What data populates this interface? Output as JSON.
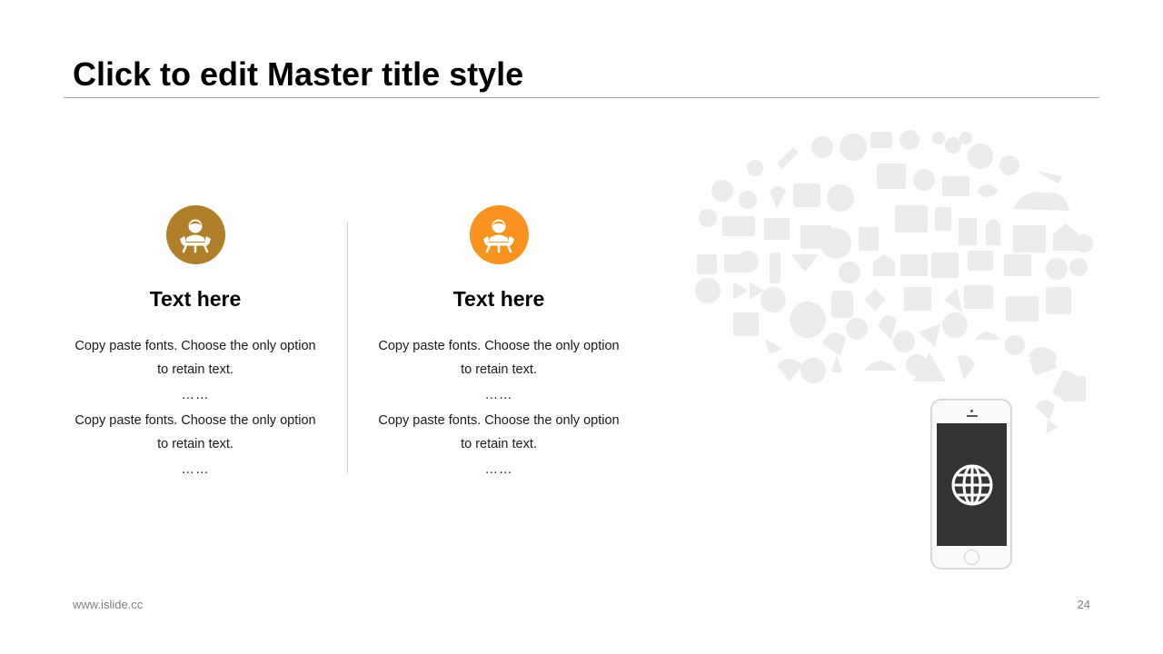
{
  "slide": {
    "title": "Click to edit Master title style",
    "columns": [
      {
        "accent": "#b07f2a",
        "icon": "user-at-desk-icon",
        "heading": "Text here",
        "para1_line1": "Copy paste fonts. Choose the only option",
        "para1_line2": "to retain text.",
        "dots1": "……",
        "para2_line1": "Copy paste fonts. Choose the only option",
        "para2_line2": "to retain text.",
        "dots2": "……"
      },
      {
        "accent": "#f7931e",
        "icon": "user-at-desk-icon",
        "heading": "Text here",
        "para1_line1": "Copy paste fonts. Choose the only option",
        "para1_line2": "to retain text.",
        "dots1": "……",
        "para2_line1": "Copy paste fonts. Choose the only option",
        "para2_line2": "to retain text.",
        "dots2": "……"
      }
    ],
    "decor": {
      "icon_cloud": "social-media-icon-cloud",
      "icon_cloud_color": "#ececec",
      "phone_icon": "globe-icon",
      "phone_screen_color": "#333333"
    }
  },
  "footer": {
    "url": "www.islide.cc",
    "page_number": "24"
  }
}
